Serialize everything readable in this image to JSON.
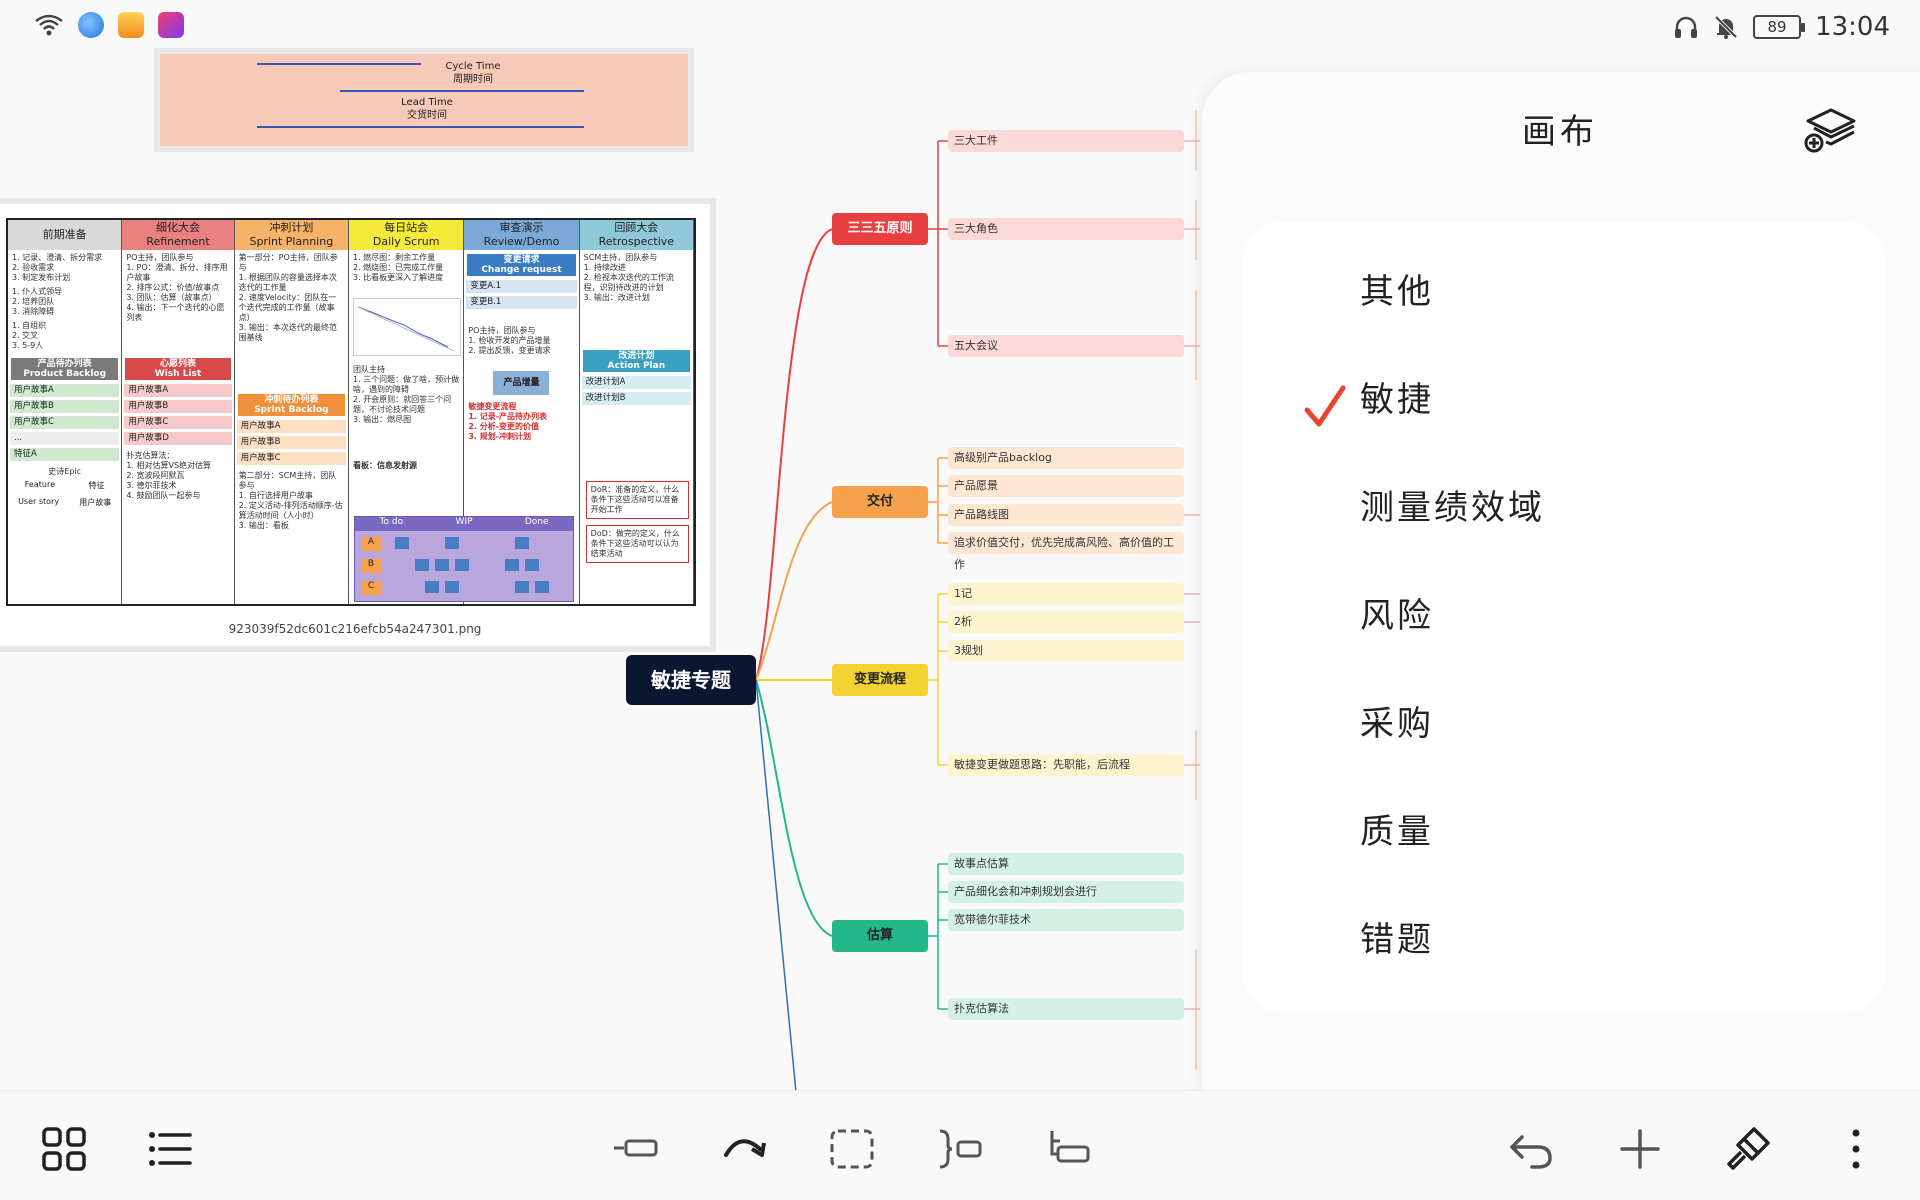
{
  "status_bar": {
    "time": "13:04",
    "battery": "89",
    "left_icons": [
      "wifi-icon",
      "browser-icon",
      "taobao-icon",
      "video-app-icon"
    ],
    "right_icons": [
      "headphones-icon",
      "mute-bell-icon",
      "battery-icon"
    ]
  },
  "image_top": {
    "labels": [
      {
        "text": "Cycle Time\n周期时间"
      },
      {
        "text": "Lead Time\n交货时间"
      }
    ]
  },
  "image_main": {
    "caption": "923039f52dc601c216efcb54a247301.png",
    "columns": [
      {
        "title": "前期准备",
        "color": "#d9d9d9"
      },
      {
        "title": "细化大会\nRefinement",
        "color": "#e88080"
      },
      {
        "title": "冲刺计划\nSprint Planning",
        "color": "#f7b26a"
      },
      {
        "title": "每日站会\nDaily Scrum",
        "color": "#f5ea3a"
      },
      {
        "title": "审查演示\nReview/Demo",
        "color": "#7aa9d8"
      },
      {
        "title": "回顾大会\nRetrospective",
        "color": "#8fc9d9"
      }
    ],
    "col1": {
      "items": [
        "1. 记录、澄清、拆分需求",
        "2. 验收需求",
        "3. 制定发布计划",
        "1. 仆人式领导",
        "2. 培养团队",
        "3. 消除障碍",
        "1. 自组织",
        "2. 交叉",
        "3. 5-9人"
      ],
      "band": "产品待办列表\nProduct Backlog",
      "stories": [
        "用户故事A",
        "用户故事B",
        "用户故事C",
        "...",
        "特征A"
      ],
      "epic": "史诗Epic",
      "feature": "Feature",
      "feature_cn": "特征",
      "user_story": "User story",
      "user_story_cn": "用户故事"
    },
    "col2": {
      "text": "PO主持，团队参与\n1. PO：澄清、拆分、排序用户故事\n2. 排序公式：价值/故事点\n3. 团队：估算（故事点）\n4. 输出：下一个迭代的心愿列表",
      "band": "心愿列表\nWish List",
      "stories": [
        "用户故事A",
        "用户故事B",
        "用户故事C",
        "用户故事D"
      ],
      "extra": "扑克估算法：\n1. 相对估算VS绝对估算\n2. 宽波段阿默瓦\n3. 德尔菲技术\n4. 鼓励团队一起参与"
    },
    "col3": {
      "text": "第一部分：PO主持，团队参与\n1. 根据团队的容量选择本次迭代的工作量\n2. 速度Velocity：团队在一个迭代完成的工作量（故事点）\n3. 输出：本次迭代的最终范围基线",
      "band": "冲刺待办列表\nSprint Backlog",
      "stories": [
        "用户故事A",
        "用户故事B",
        "用户故事C"
      ],
      "extra": "第二部分：SCM主持，团队参与\n1. 自行选择用户故事\n2. 定义活动-排列活动顺序-估算活动时间（人小时）\n3. 输出：看板"
    },
    "col4": {
      "text": "1. 燃尽图：剩余工作量\n2. 燃烧图：已完成工作量\n3. 比看板更深入了解进度",
      "text2": "团队主持\n1. 三个问题：做了啥，预计做啥，遇到的障碍\n2. 开会原则：就回答三个问题，不讨论技术问题\n3. 输出：燃尽图",
      "board_title": "看板：信息发射源",
      "board_cols": [
        "To do",
        "WIP",
        "Done"
      ],
      "rows": [
        "A",
        "B",
        "C"
      ]
    },
    "col5": {
      "band": "变更请求\nChange request",
      "items": [
        "变更A.1",
        "变更B.1"
      ],
      "text": "PO主持，团队参与\n1. 检收开发的产品增量\n2. 提出反馈，变更请求",
      "increment": "产品增量",
      "flow": "敏捷变更流程\n1. 记录-产品待办列表\n2. 分析-变更的价值\n3. 规划-冲刺计划"
    },
    "col6": {
      "text": "SCM主持，团队参与\n1. 持续改进\n2. 检视本次迭代的工作流程，识别待改进的计划\n3. 输出：改进计划",
      "band": "改进计划\nAction Plan",
      "items": [
        "改进计划A",
        "改进计划B"
      ],
      "dor": "DoR：准备的定义，什么条件下这些活动可以准备开始工作",
      "dod": "DoD：做完的定义，什么条件下这些活动可以认为结束活动"
    }
  },
  "mindmap": {
    "root": "敏捷专题",
    "branches": [
      {
        "label": "三三五原则",
        "color": "#e84040",
        "text_color": "#ffffff",
        "leaves": [
          "三大工件",
          "三大角色",
          "五大会议"
        ],
        "leaf_color": "#fbd9d9"
      },
      {
        "label": "交付",
        "color": "#f5a04a",
        "text_color": "#222222",
        "leaves": [
          "高级别产品backlog",
          "产品愿景",
          "产品路线图",
          "追求价值交付，优先完成高风险、高价值的工作"
        ],
        "leaf_color": "#fde7d3"
      },
      {
        "label": "变更流程",
        "color": "#f2d230",
        "text_color": "#222222",
        "leaves": [
          "1记",
          "2析",
          "3规划",
          "敏捷变更做题思路：先职能，后流程"
        ],
        "leaf_color": "#fcf4cf"
      },
      {
        "label": "估算",
        "color": "#22b88a",
        "text_color": "#222222",
        "leaves": [
          "故事点估算",
          "产品细化会和冲刺规划会进行",
          "宽带德尔菲技术",
          "扑克估算法"
        ],
        "leaf_color": "#d4f1e5"
      }
    ]
  },
  "panel": {
    "title": "画布",
    "layers_icon": "layers-add-icon",
    "categories": [
      "其他",
      "敏捷",
      "测量绩效域",
      "风险",
      "采购",
      "质量",
      "错题"
    ],
    "selected": "敏捷",
    "accent": "#e8452c"
  },
  "toolbar": {
    "left": [
      "grid-view-icon",
      "outline-list-icon"
    ],
    "center": [
      "insert-sibling-topic-icon",
      "relationship-arrow-icon",
      "boundary-select-icon",
      "summary-bracket-icon",
      "insert-child-topic-icon"
    ],
    "right": [
      "undo-icon",
      "add-icon",
      "format-brush-icon",
      "more-vert-icon"
    ]
  }
}
